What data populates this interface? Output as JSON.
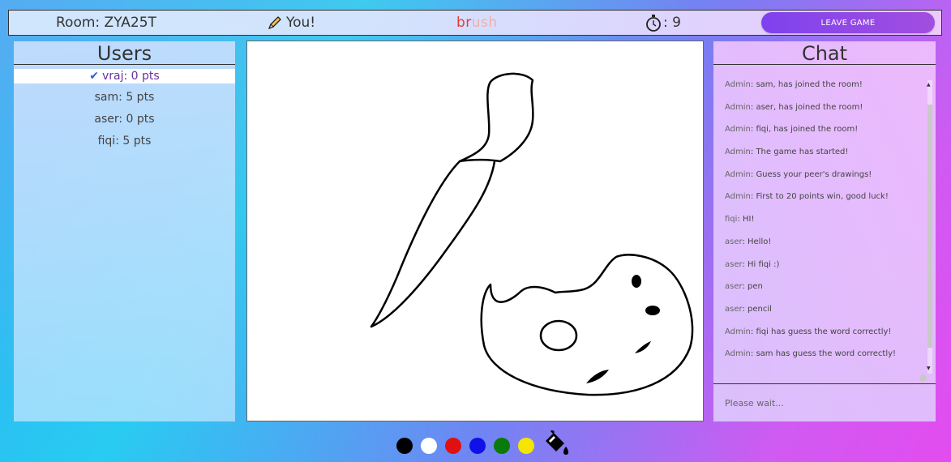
{
  "topbar": {
    "room": "Room: ZYA25T",
    "drawer": "You!",
    "word_prefix": "br",
    "word_suffix": "ush",
    "timer_value": ": 9",
    "leave_label": "LEAVE GAME"
  },
  "users": {
    "title": "Users",
    "items": [
      {
        "label": "vraj: 0 pts"
      },
      {
        "label": "sam: 5 pts"
      },
      {
        "label": "aser: 0 pts"
      },
      {
        "label": "fiqi: 5 pts"
      }
    ]
  },
  "chat": {
    "title": "Chat",
    "messages": [
      {
        "sender": "Admin",
        "text": "sam, has joined the room!"
      },
      {
        "sender": "Admin",
        "text": "aser, has joined the room!"
      },
      {
        "sender": "Admin",
        "text": "fiqi, has joined the room!"
      },
      {
        "sender": "Admin",
        "text": "The game has started!"
      },
      {
        "sender": "Admin",
        "text": "Guess your peer's drawings!"
      },
      {
        "sender": "Admin",
        "text": "First to 20 points win, good luck!"
      },
      {
        "sender": "fiqi",
        "text": "HI!"
      },
      {
        "sender": "aser",
        "text": "Hello!"
      },
      {
        "sender": "aser",
        "text": "Hi fiqi :)"
      },
      {
        "sender": "aser",
        "text": "pen"
      },
      {
        "sender": "aser",
        "text": "pencil"
      },
      {
        "sender": "Admin",
        "text": "fiqi has guess the word correctly!"
      },
      {
        "sender": "Admin",
        "text": "sam has guess the word correctly!"
      }
    ],
    "input_placeholder": "Please wait..."
  },
  "palette": {
    "colors": [
      "#000000",
      "#ffffff",
      "#e01010",
      "#1010e8",
      "#0a7a0a",
      "#f5e600"
    ],
    "fill_tool_icon": "paint-bucket-icon"
  },
  "icons": {
    "drawer": "pencil-icon",
    "timer": "stopwatch-icon",
    "active_user": "check-icon"
  }
}
